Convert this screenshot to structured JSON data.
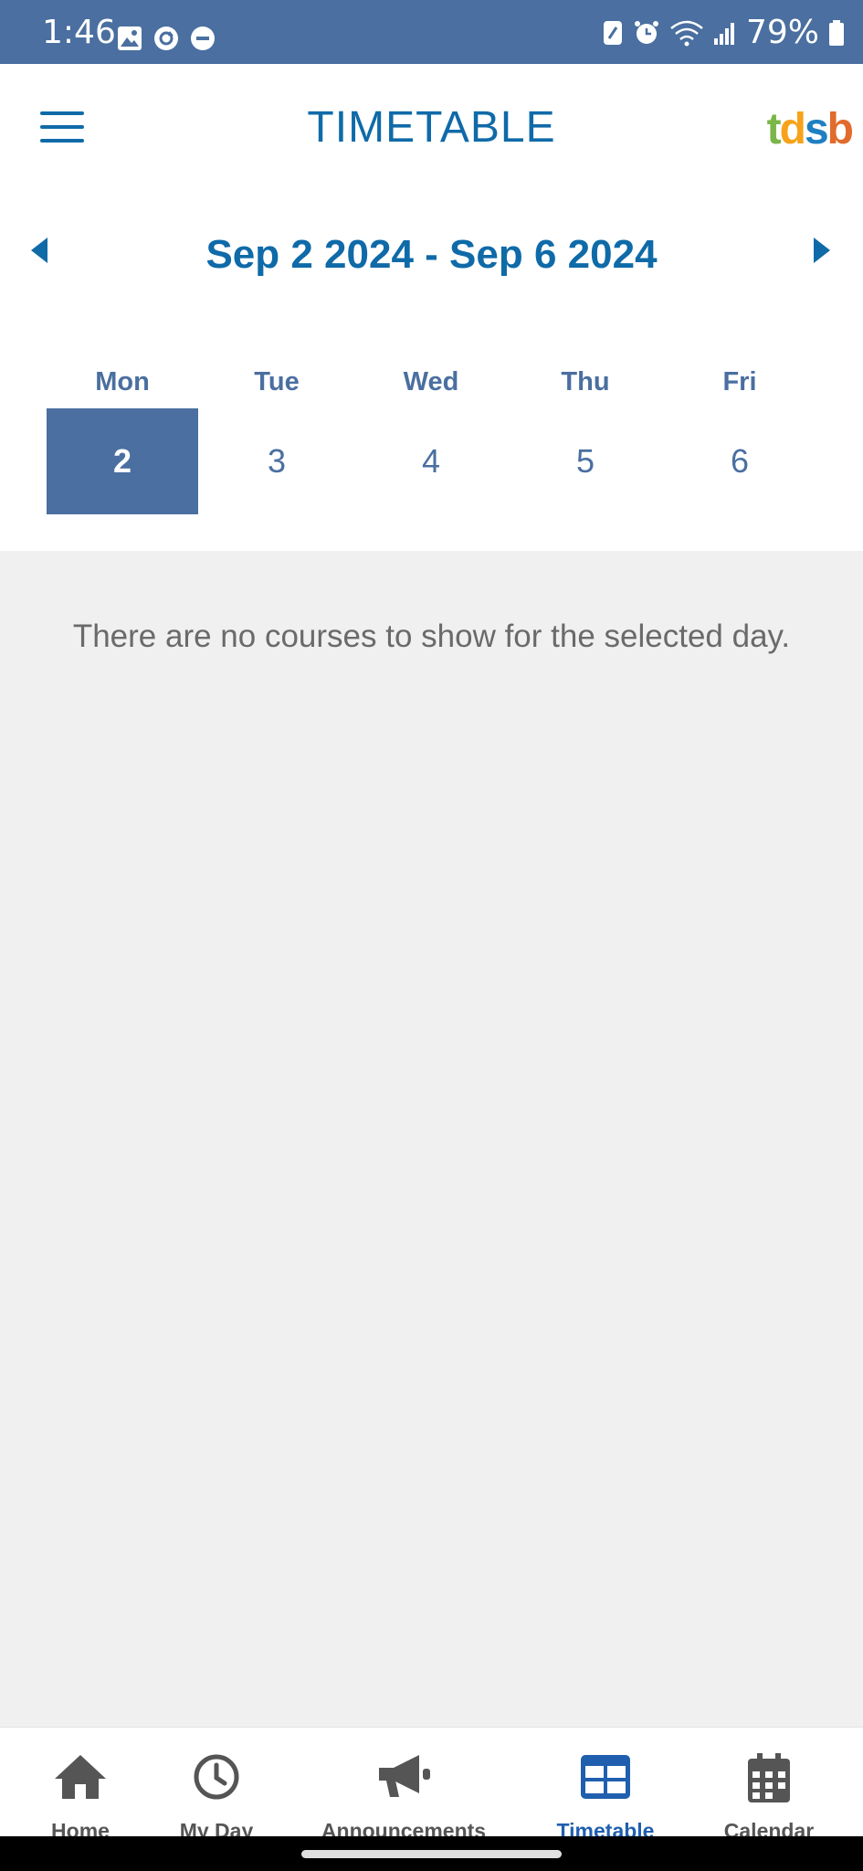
{
  "status_bar": {
    "time": "1:46",
    "battery": "79%",
    "icons": [
      "image-icon",
      "sync-icon",
      "do-not-disturb-icon",
      "nfc-icon",
      "alarm-icon",
      "wifi-icon",
      "signal-icon",
      "battery-icon"
    ]
  },
  "header": {
    "title": "TIMETABLE",
    "logo": {
      "t": "t",
      "d": "d",
      "s": "s",
      "b": "b"
    },
    "menu_icon": "hamburger-icon"
  },
  "week": {
    "range": "Sep 2 2024 - Sep 6 2024",
    "days": [
      {
        "name": "Mon",
        "date": "2",
        "selected": true
      },
      {
        "name": "Tue",
        "date": "3",
        "selected": false
      },
      {
        "name": "Wed",
        "date": "4",
        "selected": false
      },
      {
        "name": "Thu",
        "date": "5",
        "selected": false
      },
      {
        "name": "Fri",
        "date": "6",
        "selected": false
      }
    ]
  },
  "content": {
    "empty_message": "There are no courses to show for the selected day."
  },
  "nav": {
    "items": [
      {
        "label": "Home",
        "icon": "home-icon",
        "active": false
      },
      {
        "label": "My Day",
        "icon": "clock-icon",
        "active": false
      },
      {
        "label": "Announcements",
        "icon": "megaphone-icon",
        "active": false
      },
      {
        "label": "Timetable",
        "icon": "timetable-icon",
        "active": true
      },
      {
        "label": "Calendar",
        "icon": "calendar-icon",
        "active": false
      }
    ]
  },
  "colors": {
    "brand_blue": "#4a6fa0",
    "title_blue": "#0f6aa8",
    "active_nav": "#1f5fae",
    "nav_inactive": "#555555",
    "background": "#f0f0f0"
  }
}
